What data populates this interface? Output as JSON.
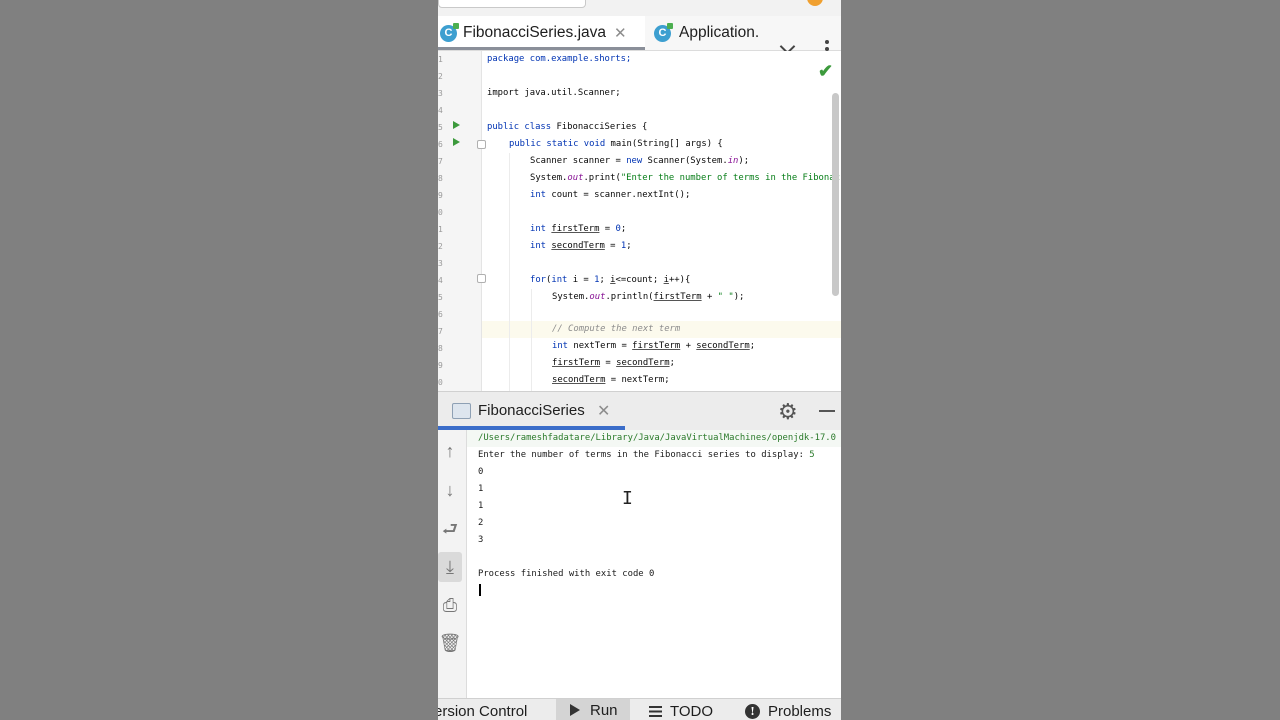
{
  "editor_tabs": [
    {
      "label": "FibonacciSeries.java",
      "icon": "java-class-icon",
      "active": true
    },
    {
      "label": "Application.",
      "icon": "java-class-icon",
      "active": false
    }
  ],
  "line_numbers": [
    "1",
    "2",
    "3",
    "4",
    "5",
    "6",
    "7",
    "8",
    "9",
    "0",
    "1",
    "2",
    "3",
    "4",
    "5",
    "6",
    "7",
    "8",
    "9",
    "0"
  ],
  "code": {
    "l1": "package com.example.shorts;",
    "l3": "import java.util.Scanner;",
    "l5a": "public class",
    "l5b": " FibonacciSeries {",
    "l6a": "public static void",
    "l6b": " main(String[] args) {",
    "l7a": "Scanner scanner = ",
    "l7b": "new",
    "l7c": " Scanner(System.",
    "l7d": "in",
    "l7e": ");",
    "l8a": "System.",
    "l8b": "out",
    "l8c": ".print(",
    "l8d": "\"Enter the number of terms in the Fibonac",
    "l9a": "int",
    "l9b": " count = scanner.nextInt();",
    "l11a": "int",
    "l11b": "firstTerm",
    "l11c": " = ",
    "l11d": "0",
    "l11e": ";",
    "l12a": "int",
    "l12b": "secondTerm",
    "l12c": " = ",
    "l12d": "1",
    "l12e": ";",
    "l14a": "for",
    "l14b": "(",
    "l14c": "int",
    "l14d": " i = ",
    "l14e": "1",
    "l14f": "; ",
    "l14g": "i",
    "l14h": "<=count; ",
    "l14i": "i",
    "l14j": "++){",
    "l15a": "System.",
    "l15b": "out",
    "l15c": ".println(",
    "l15d": "firstTerm",
    "l15e": " + ",
    "l15f": "\" \"",
    "l15g": ");",
    "l17": "// Compute the next term",
    "l18a": "int",
    "l18b": " nextTerm = ",
    "l18c": "firstTerm",
    "l18d": " + ",
    "l18e": "secondTerm",
    "l18f": ";",
    "l19a": "firstTerm",
    "l19b": " = ",
    "l19c": "secondTerm",
    "l19d": ";",
    "l20a": "secondTerm",
    "l20b": " = nextTerm;"
  },
  "run_panel": {
    "title": "FibonacciSeries",
    "command": "/Users/rameshfadatare/Library/Java/JavaVirtualMachines/openjdk-17.0",
    "prompt": "Enter the number of terms in the Fibonacci series to display: ",
    "input_value": "5",
    "output": [
      "0",
      "1",
      "1",
      "2",
      "3"
    ],
    "exit_message": "Process finished with exit code 0"
  },
  "bottom_bar": {
    "version_control": "ersion Control",
    "run": "Run",
    "todo": "TODO",
    "problems": "Problems"
  },
  "colors": {
    "keyword": "#0033b3",
    "string": "#067d17",
    "run_gutter": "#3c9a3c",
    "active_tab_underline": "#3b6dc9"
  }
}
